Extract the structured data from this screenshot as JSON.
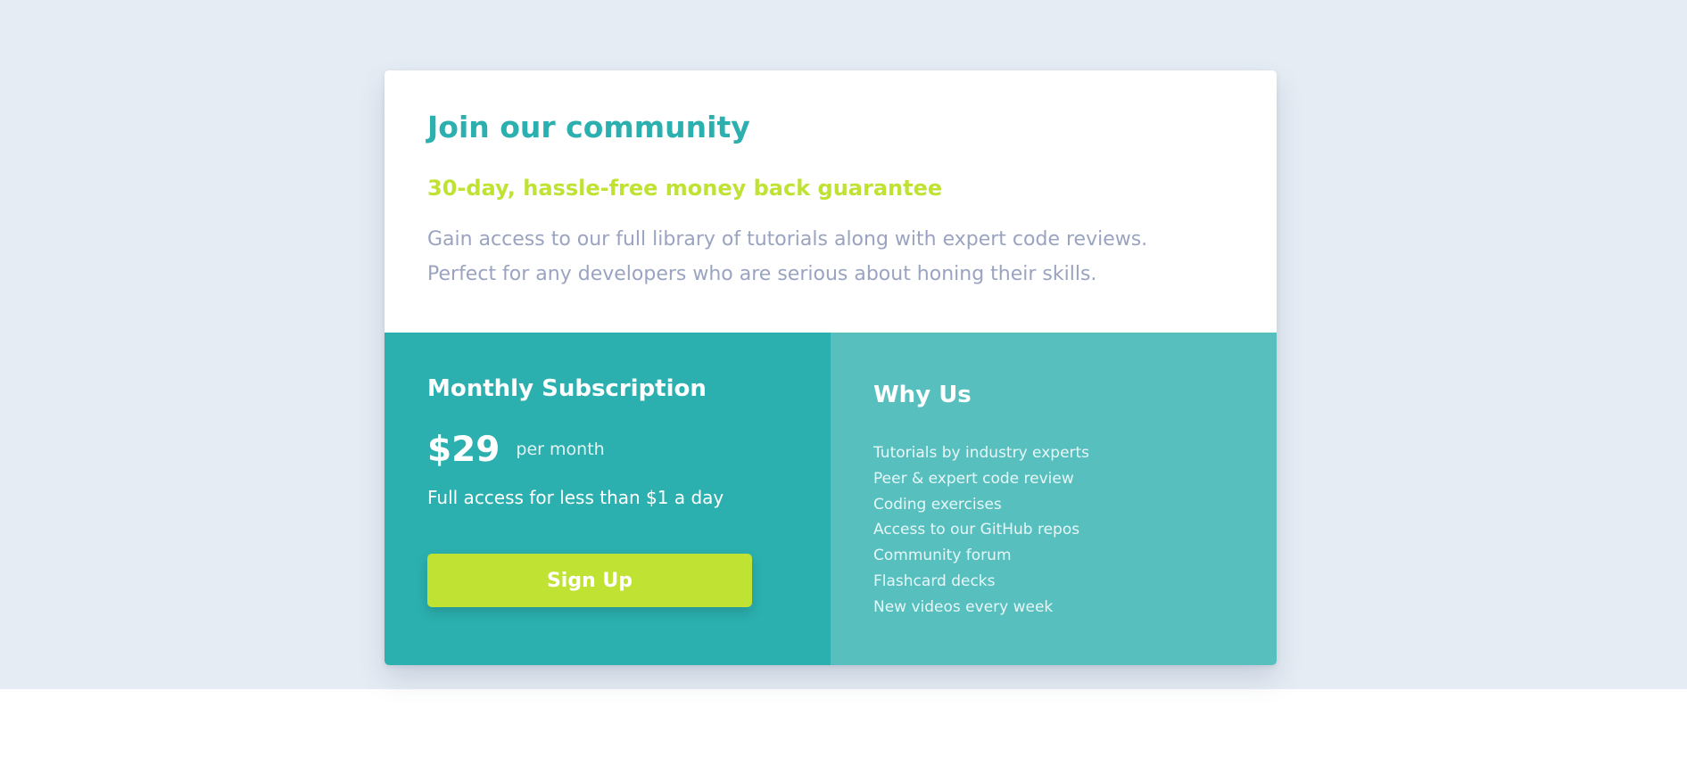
{
  "colors": {
    "background": "#e5ecf4",
    "accent_teal": "#2bb0af",
    "accent_light_teal": "#58bfbf",
    "accent_lime": "#bfe233",
    "muted_text": "#9aa4c0"
  },
  "card": {
    "title": "Join our community",
    "subtitle": "30-day, hassle-free money back guarantee",
    "description": "Gain access to our full library of tutorials along with expert code reviews. Perfect for any developers who are serious about honing their skills."
  },
  "subscription": {
    "title": "Monthly Subscription",
    "price": "$29",
    "period": "per month",
    "note": "Full access for less than $1 a day",
    "button_label": "Sign Up"
  },
  "why_us": {
    "title": "Why Us",
    "items": [
      "Tutorials by industry experts",
      "Peer & expert code review",
      "Coding exercises",
      "Access to our GitHub repos",
      "Community forum",
      "Flashcard decks",
      "New videos every week"
    ]
  }
}
